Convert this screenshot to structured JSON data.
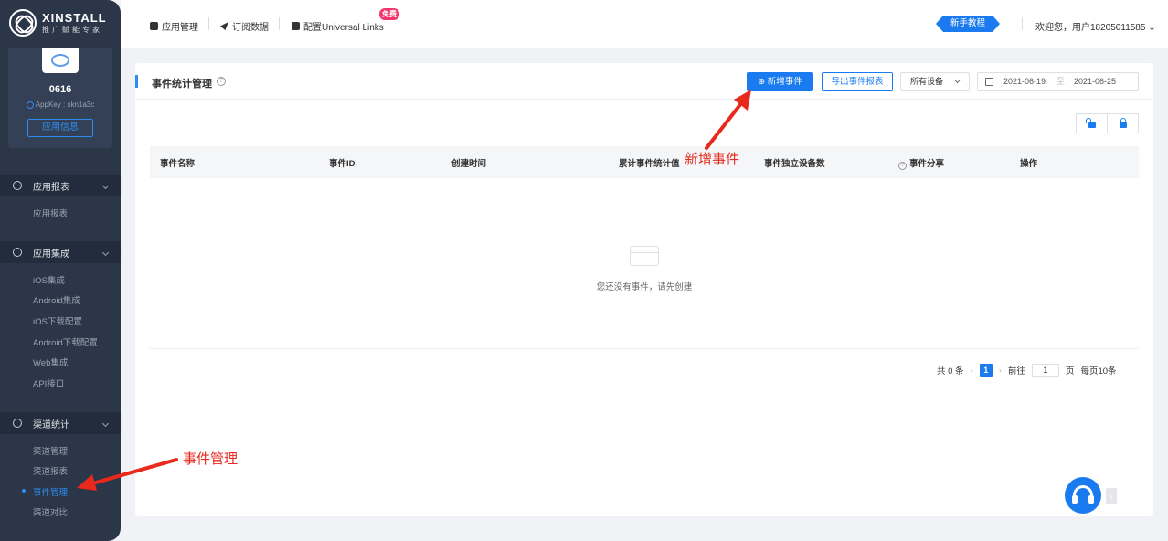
{
  "brand": {
    "title": "XINSTALL",
    "subtitle": "推广赋能专家"
  },
  "app": {
    "name": "0616",
    "appkey": "AppKey : skn1a3c",
    "info_button": "应用信息"
  },
  "sidebar": {
    "groups": [
      {
        "label": "应用报表",
        "icon": "pie-chart-icon",
        "items": [
          "应用报表"
        ]
      },
      {
        "label": "应用集成",
        "icon": "cube-icon",
        "items": [
          "iOS集成",
          "Android集成",
          "iOS下载配置",
          "Android下载配置",
          "Web集成",
          "API接口"
        ]
      },
      {
        "label": "渠道统计",
        "icon": "share-icon",
        "items": [
          "渠道管理",
          "渠道报表",
          "事件管理",
          "渠道对比"
        ]
      }
    ],
    "active_item": "事件管理"
  },
  "topbar": {
    "nav": [
      "应用管理",
      "订阅数据",
      "配置Universal Links"
    ],
    "free_badge": "免费",
    "tutorial": "新手教程",
    "welcome": "欢迎您，用户18205011585"
  },
  "panel": {
    "title": "事件统计管理",
    "add_event": "新增事件",
    "export": "导出事件报表",
    "device_select": "所有设备",
    "date_start": "2021-06-19",
    "date_sep": "至",
    "date_end": "2021-06-25",
    "columns": [
      "事件名称",
      "事件ID",
      "创建时间",
      "累计事件统计值",
      "事件独立设备数",
      "事件分享",
      "操作"
    ],
    "empty_text": "您还没有事件，请先创建",
    "pager": {
      "total": "共 0 条",
      "current_page": "1",
      "goto_label": "前往",
      "goto_value": "1",
      "page_suffix": "页",
      "page_size": "每页10条"
    }
  },
  "annotations": {
    "add_event": "新增事件",
    "event_manage": "事件管理"
  },
  "colors": {
    "accent": "#1a7bf0",
    "sidebar_bg": "#2b3649",
    "annotation": "#e8291c",
    "badge": "#f5366c"
  }
}
